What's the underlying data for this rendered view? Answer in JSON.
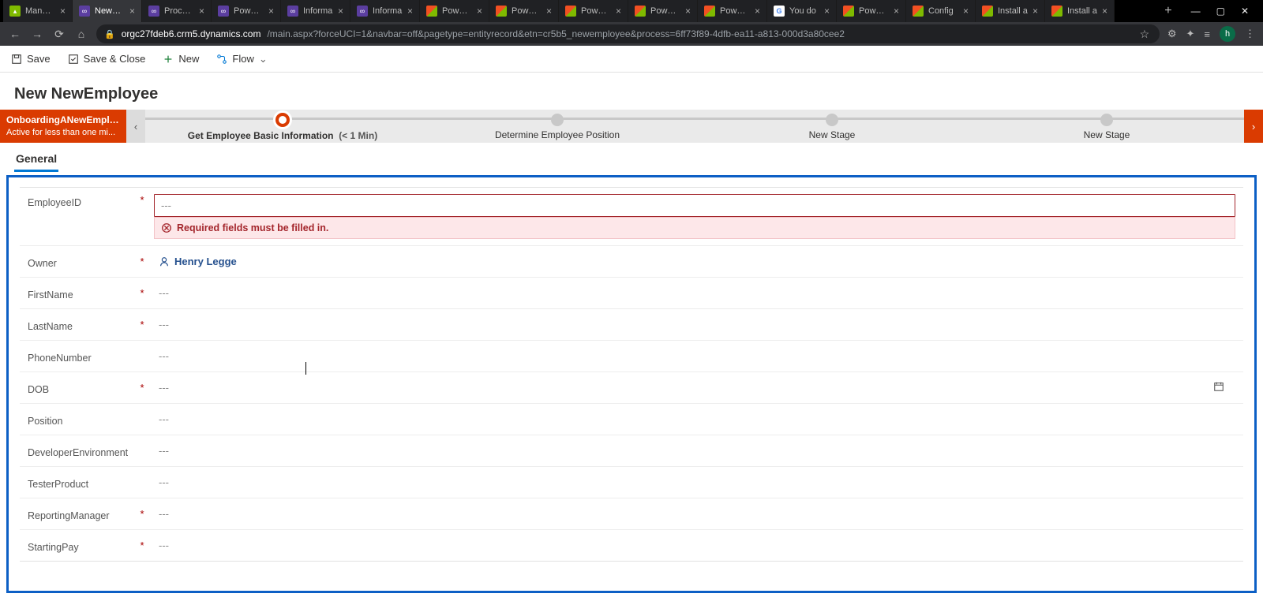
{
  "browser": {
    "tabs": [
      {
        "label": "Manage",
        "fav": "az"
      },
      {
        "label": "NewEm",
        "fav": "pa",
        "active": true
      },
      {
        "label": "Process",
        "fav": "pa"
      },
      {
        "label": "Power A",
        "fav": "pa"
      },
      {
        "label": "Informa",
        "fav": "pa"
      },
      {
        "label": "Informa",
        "fav": "pa"
      },
      {
        "label": "Power P",
        "fav": "ms"
      },
      {
        "label": "Power P",
        "fav": "ms"
      },
      {
        "label": "Power P",
        "fav": "ms"
      },
      {
        "label": "Power P",
        "fav": "ms"
      },
      {
        "label": "Power P",
        "fav": "ms"
      },
      {
        "label": "You do",
        "fav": "g"
      },
      {
        "label": "Power P",
        "fav": "ms"
      },
      {
        "label": "Config",
        "fav": "ms"
      },
      {
        "label": "Install a",
        "fav": "ms"
      },
      {
        "label": "Install a",
        "fav": "ms"
      }
    ],
    "url_host": "orgc27fdeb6.crm5.dynamics.com",
    "url_path": "/main.aspx?forceUCI=1&navbar=off&pagetype=entityrecord&etn=cr5b5_newemployee&process=6ff73f89-4dfb-ea11-a813-000d3a80cee2",
    "profile_initial": "h"
  },
  "commands": {
    "save": "Save",
    "save_close": "Save & Close",
    "new": "New",
    "flow": "Flow"
  },
  "page_title": "New NewEmployee",
  "process": {
    "name": "OnboardingANewEmplo...",
    "status": "Active for less than one mi...",
    "stages": [
      {
        "label": "Get Employee Basic Information",
        "duration": "(< 1 Min)",
        "active": true
      },
      {
        "label": "Determine Employee Position"
      },
      {
        "label": "New Stage"
      },
      {
        "label": "New Stage"
      }
    ]
  },
  "tab_general": "General",
  "error_msg": "Required fields must be filled in.",
  "fields": {
    "employeeid": {
      "label": "EmployeeID",
      "req": true,
      "value": "---"
    },
    "owner": {
      "label": "Owner",
      "req": true,
      "value": "Henry Legge"
    },
    "firstname": {
      "label": "FirstName",
      "req": true,
      "value": "---"
    },
    "lastname": {
      "label": "LastName",
      "req": true,
      "value": "---"
    },
    "phone": {
      "label": "PhoneNumber",
      "req": false,
      "value": "---"
    },
    "dob": {
      "label": "DOB",
      "req": true,
      "value": "---"
    },
    "position": {
      "label": "Position",
      "req": false,
      "value": "---"
    },
    "devenv": {
      "label": "DeveloperEnvironment",
      "req": false,
      "value": "---"
    },
    "tester": {
      "label": "TesterProduct",
      "req": false,
      "value": "---"
    },
    "repmgr": {
      "label": "ReportingManager",
      "req": true,
      "value": "---"
    },
    "startpay": {
      "label": "StartingPay",
      "req": true,
      "value": "---"
    }
  }
}
